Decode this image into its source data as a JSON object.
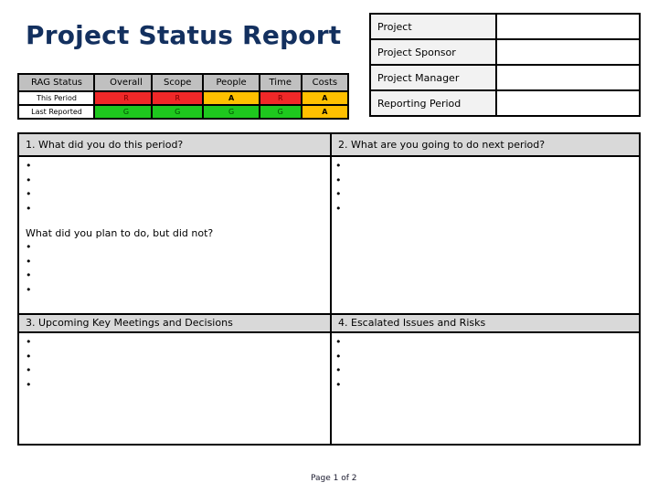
{
  "header": {
    "title": "Project Status Report"
  },
  "rag": {
    "label_header": "RAG Status",
    "row_labels": [
      "This Period",
      "Last Reported"
    ],
    "overall": {
      "header": "Overall",
      "this_period": "R",
      "last_reported": "G"
    },
    "metrics": [
      {
        "name": "Scope",
        "this_period": "R",
        "last_reported": "G"
      },
      {
        "name": "People",
        "this_period": "A",
        "last_reported": "G"
      },
      {
        "name": "Time",
        "this_period": "R",
        "last_reported": "G"
      },
      {
        "name": "Costs",
        "this_period": "A",
        "last_reported": "A"
      }
    ],
    "colors": {
      "R": "#f02828",
      "A": "#ffc000",
      "G": "#1ec81e"
    }
  },
  "info": {
    "fields": [
      {
        "label": "Project",
        "value": ""
      },
      {
        "label": "Project Sponsor",
        "value": ""
      },
      {
        "label": "Project Manager",
        "value": ""
      },
      {
        "label": "Reporting Period",
        "value": ""
      }
    ]
  },
  "sections": {
    "done": {
      "title": "1. What did you do this period?",
      "bullets": [
        "",
        "",
        "",
        ""
      ]
    },
    "next": {
      "title": "2. What are you going to do next period?",
      "bullets": [
        "",
        "",
        "",
        ""
      ]
    },
    "not_done": {
      "title": "What did you plan to do, but did not?",
      "bullets": [
        "",
        "",
        "",
        ""
      ]
    },
    "meetings": {
      "title": "3. Upcoming Key Meetings and Decisions",
      "bullets": [
        "",
        "",
        "",
        ""
      ]
    },
    "risks": {
      "title": "4. Escalated Issues and Risks",
      "bullets": [
        "",
        "",
        "",
        ""
      ]
    }
  },
  "footer": {
    "page_label": "Page 1 of 2"
  }
}
